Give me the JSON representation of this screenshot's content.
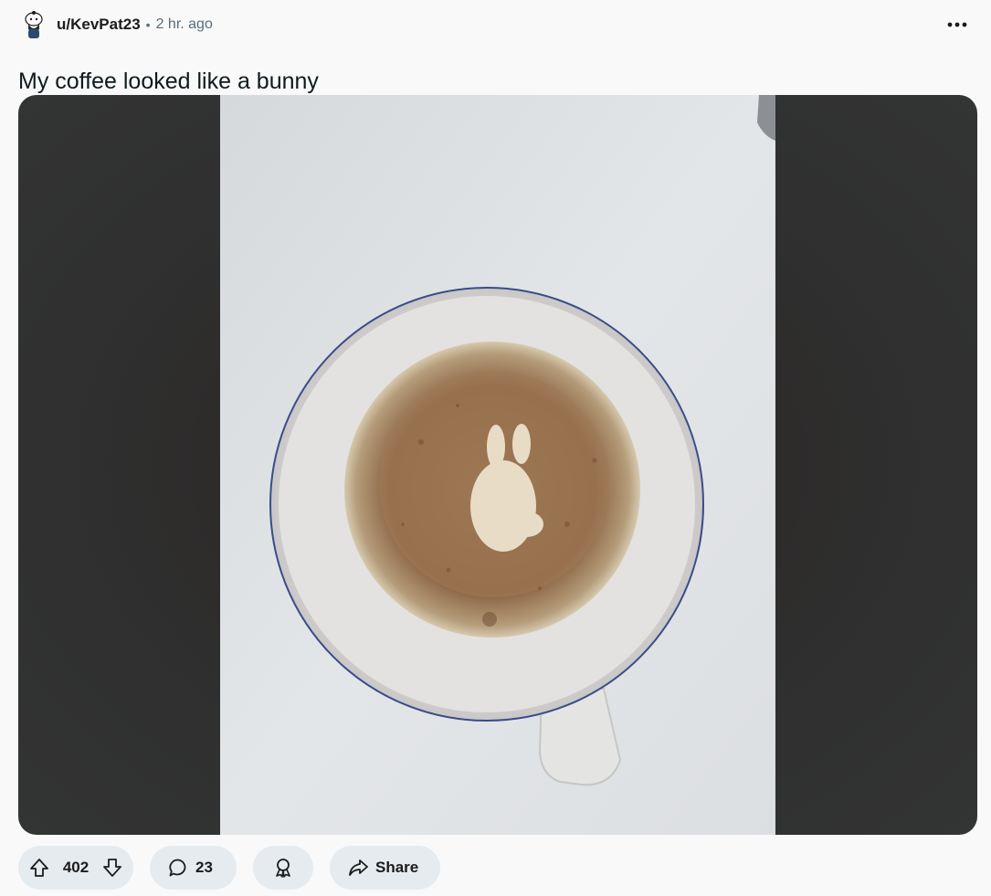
{
  "post": {
    "author": "u/KevPat23",
    "separator": "•",
    "time": "2 hr. ago",
    "title": "My coffee looked like a bunny"
  },
  "actions": {
    "score": "402",
    "comments": "23",
    "share_label": "Share"
  },
  "icons": {
    "avatar": "avatar-icon",
    "more": "more-options-icon",
    "upvote": "upvote-arrow-icon",
    "downvote": "downvote-arrow-icon",
    "comment": "comment-bubble-icon",
    "award": "award-ribbon-icon",
    "share": "share-arrow-icon"
  },
  "colors": {
    "pill_bg": "#e5ebee",
    "meta_text": "#576f76",
    "media_bg": "#2f2f2f"
  }
}
